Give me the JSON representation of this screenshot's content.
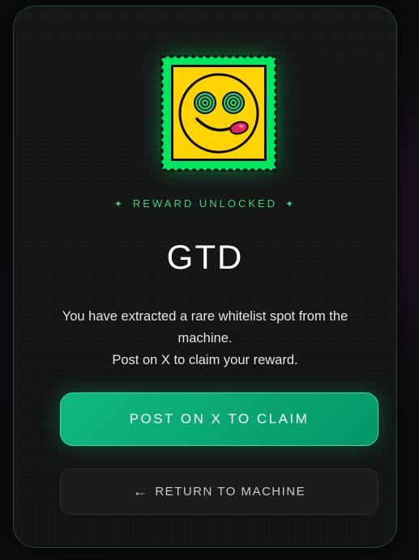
{
  "reward": {
    "eyebrow": "REWARD UNLOCKED",
    "eyebrow_icon": "sparkle-icon",
    "title": "GTD",
    "description_line1": "You have extracted a rare whitelist spot from the machine.",
    "description_line2": "Post on X to claim your reward.",
    "stamp_icon": "smiley-hypno-icon"
  },
  "actions": {
    "claim_label": "POST ON X TO CLAIM",
    "return_arrow": "←",
    "return_label": "RETURN TO MACHINE"
  },
  "colors": {
    "accent_green": "#10b981",
    "glow_green": "#00f26a",
    "eyebrow_green": "#3fcf7a",
    "stamp_yellow": "#ffd400",
    "card_border": "#1f4a33"
  }
}
